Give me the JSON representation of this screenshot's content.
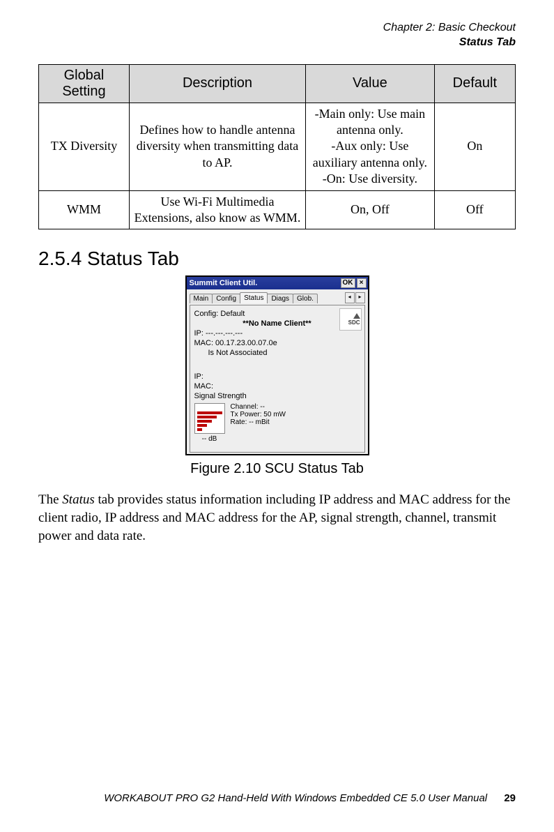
{
  "header": {
    "line1": "Chapter 2: Basic Checkout",
    "line2": "Status Tab"
  },
  "table": {
    "headers": {
      "setting": "Global Setting",
      "description": "Description",
      "value": "Value",
      "default": "Default"
    },
    "rows": [
      {
        "setting": "TX Diversity",
        "description": "Defines how to handle antenna diversity when transmitting data to AP.",
        "value": "-Main only: Use main antenna only.\n-Aux only: Use auxiliary antenna only.\n-On: Use diversity.",
        "default": "On"
      },
      {
        "setting": "WMM",
        "description": "Use Wi-Fi Multimedia Extensions, also know as WMM.",
        "value": "On, Off",
        "default": "Off"
      }
    ]
  },
  "section": {
    "number_title": "2.5.4  Status Tab"
  },
  "scu": {
    "window_title": "Summit Client Util.",
    "ok_label": "OK",
    "close_label": "×",
    "tabs": [
      "Main",
      "Config",
      "Status",
      "Diags",
      "Glob."
    ],
    "active_tab_index": 2,
    "logo_text": "SDC",
    "lines": {
      "config": "Config: Default",
      "client": "**No Name Client**",
      "ip1": "IP:    ---.---.---.---",
      "mac1": "MAC:  00.17.23.00.07.0e",
      "assoc": "Is Not Associated",
      "ip2": "IP:",
      "mac2": "MAC:",
      "sig_label": "Signal Strength"
    },
    "signal": {
      "db": "-- dB",
      "channel": "Channel: --",
      "tx": "Tx Power: 50 mW",
      "rate": "Rate: -- mBit"
    }
  },
  "figure_caption": "Figure 2.10 SCU Status Tab",
  "paragraph": {
    "pre": "The ",
    "ital": "Status",
    "post": " tab provides status information including IP address and MAC address for the client radio, IP address and MAC address for the AP, signal strength, channel, transmit power and data rate."
  },
  "footer": {
    "text": "WORKABOUT PRO G2 Hand-Held With Windows Embedded CE 5.0 User Manual",
    "page": "29"
  }
}
